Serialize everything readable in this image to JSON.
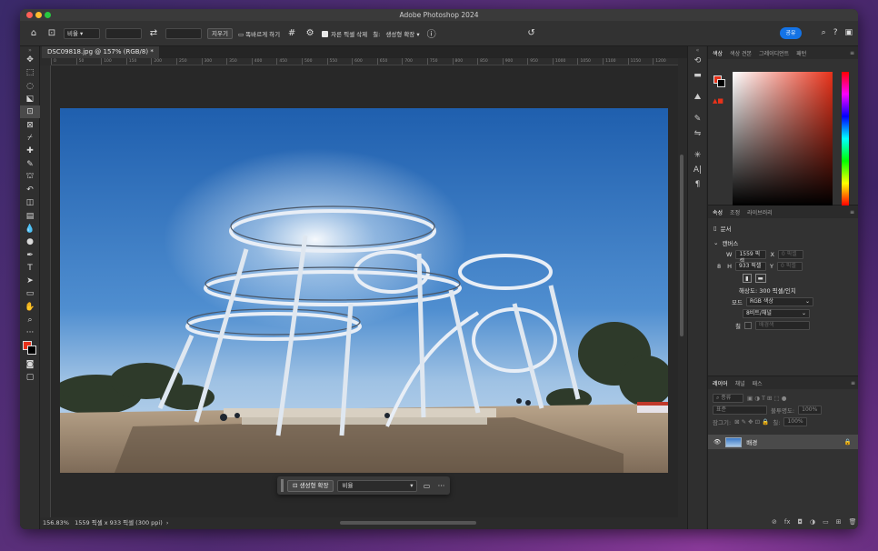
{
  "window": {
    "title": "Adobe Photoshop 2024"
  },
  "options_bar": {
    "ratio_select": "비율",
    "erase_label": "지우기",
    "straighten_label": "똑바르게 하기",
    "delete_cropped_label": "자른 픽셀 삭제",
    "fill_label": "칠:",
    "fill_value": "생성형 확장",
    "share_label": "공유"
  },
  "document": {
    "tab_title": "DSC09818.jpg @ 157% (RGB/8) *",
    "zoom": "156.83%",
    "status": "1559 픽셀 x 933 픽셀 (300 ppi)"
  },
  "ruler_ticks": [
    "0",
    "50",
    "100",
    "150",
    "200",
    "250",
    "300",
    "350",
    "400",
    "450",
    "500",
    "550",
    "600",
    "650",
    "700",
    "750",
    "800",
    "850",
    "900",
    "950",
    "1000",
    "1050",
    "1100",
    "1150",
    "1200",
    "1250",
    "1300",
    "1350",
    "1400",
    "1450",
    "1500",
    "1550"
  ],
  "context_bar": {
    "generate_label": "생성형 확장",
    "ratio_value": "비율"
  },
  "color_panel": {
    "tabs": [
      "색상",
      "색상 견본",
      "그레이디언트",
      "패턴"
    ],
    "foreground": "#e8321a",
    "background": "#000000"
  },
  "properties": {
    "tabs": [
      "속성",
      "조정",
      "라이브러리"
    ],
    "doc_label": "문서",
    "canvas_header": "캔버스",
    "w_label": "W",
    "w_value": "1559 픽셀",
    "x_label": "X",
    "x_placeholder": "0 픽셀",
    "h_label": "H",
    "h_value": "933 픽셀",
    "y_label": "Y",
    "y_placeholder": "0 픽셀",
    "resolution": "해상도: 300 픽셀/인치",
    "mode_label": "모드",
    "mode_value": "RGB 색상",
    "depth_value": "8비트/채널",
    "fill_label": "칠",
    "fill_value": "배경색"
  },
  "layers": {
    "tabs": [
      "레이어",
      "채널",
      "패스"
    ],
    "kind_label": "종류",
    "blend_mode": "표준",
    "opacity_label": "불투명도:",
    "opacity_value": "100%",
    "lock_label": "잠그기:",
    "fill_label": "칠:",
    "fill_value": "100%",
    "layer_name": "배경"
  }
}
